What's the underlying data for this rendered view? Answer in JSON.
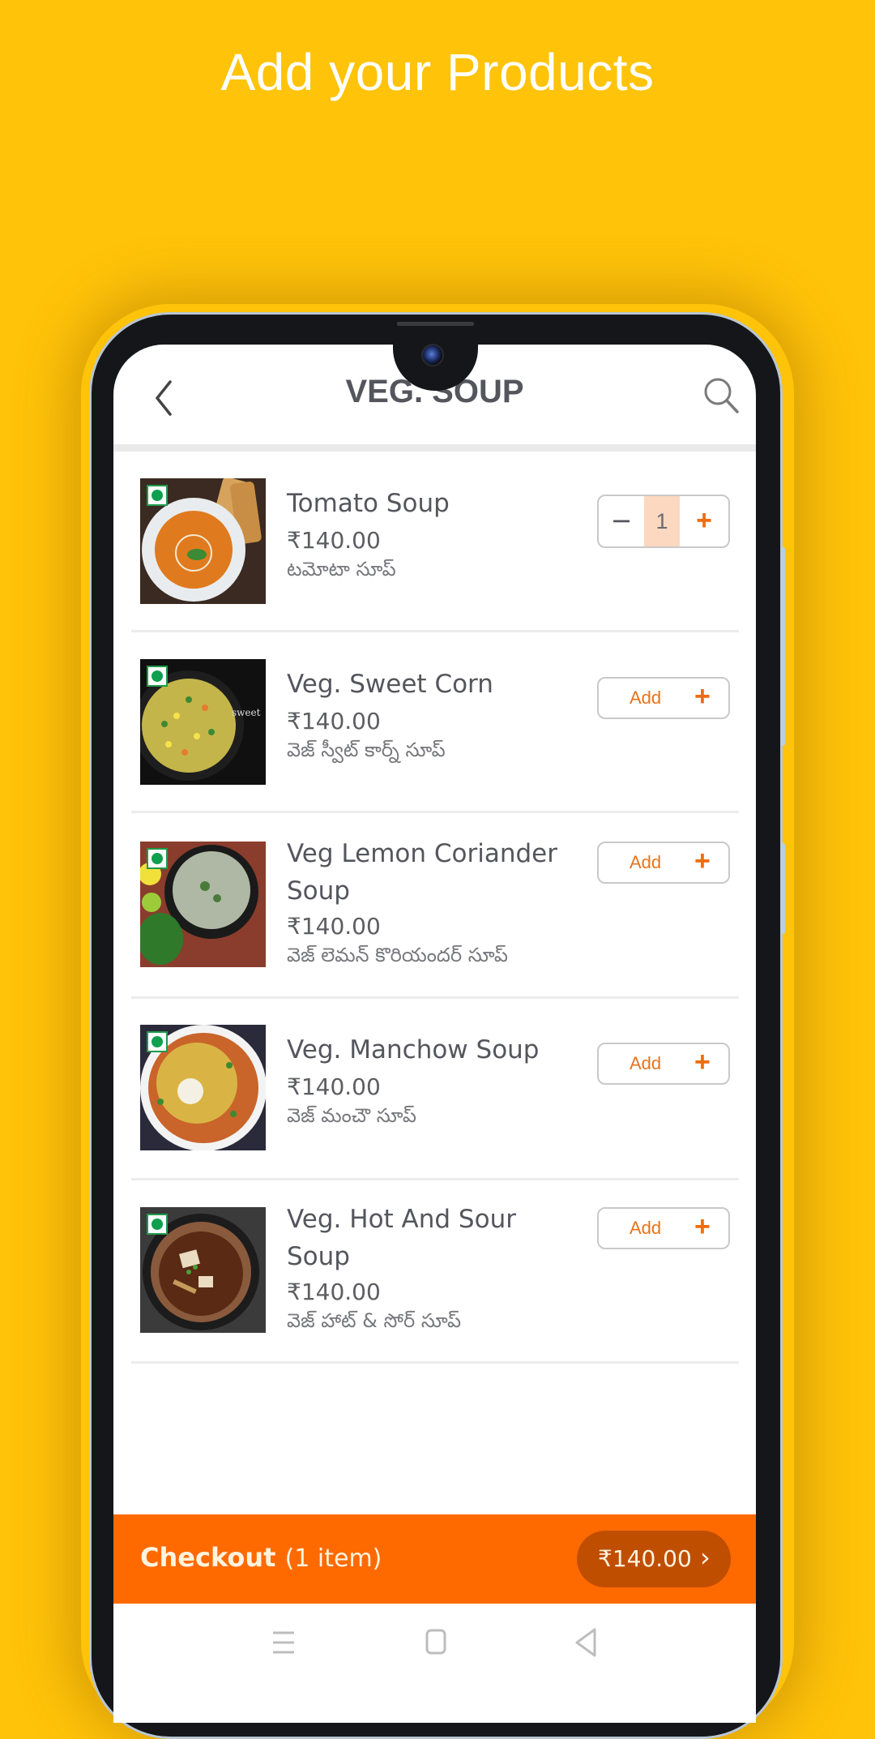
{
  "promo": {
    "title": "Add your Products"
  },
  "header": {
    "title": "VEG. SOUP",
    "back_icon": "chevron-left-icon",
    "search_icon": "search-icon"
  },
  "items": [
    {
      "name": "Tomato Soup",
      "price": "₹140.00",
      "local_name": "టమోటా సూప్",
      "veg": true,
      "quantity": "1",
      "in_cart": true
    },
    {
      "name": "Veg. Sweet Corn",
      "price": "₹140.00",
      "local_name": "వెజ్ స్వీట్ కార్న్ సూప్",
      "veg": true,
      "add_label": "Add",
      "in_cart": false
    },
    {
      "name": "Veg Lemon Coriander Soup",
      "price": "₹140.00",
      "local_name": "వెజ్ లెమన్ కొరియందర్ సూప్",
      "veg": true,
      "add_label": "Add",
      "in_cart": false
    },
    {
      "name": "Veg. Manchow Soup",
      "price": "₹140.00",
      "local_name": "వెజ్ మంచౌ సూప్",
      "veg": true,
      "add_label": "Add",
      "in_cart": false
    },
    {
      "name": "Veg. Hot And Sour Soup",
      "price": "₹140.00",
      "local_name": "వెజ్ హాట్ & సోర్ సూప్",
      "veg": true,
      "add_label": "Add",
      "in_cart": false
    }
  ],
  "stepper": {
    "minus": "−",
    "plus": "+"
  },
  "add_plus": "+",
  "checkout": {
    "label": "Checkout",
    "count": "(1 item)",
    "amount": "₹140.00",
    "chevron": "›"
  },
  "colors": {
    "background": "#FFC309",
    "accent": "#FF6A00",
    "pill": "#C04E00",
    "veg": "#0EA04E"
  }
}
